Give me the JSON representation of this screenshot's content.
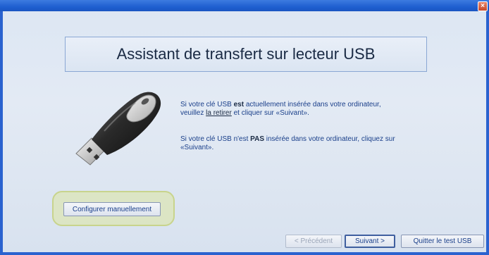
{
  "window": {
    "close_glyph": "×"
  },
  "header": {
    "title": "Assistant de transfert sur lecteur USB"
  },
  "message1": {
    "line1_a": "Si votre clé USB ",
    "line1_bold": "est",
    "line1_b": " actuellement insérée dans votre ordinateur,",
    "line2_a": "veuillez ",
    "line2_link": "la retirer",
    "line2_b": " et cliquer sur «Suivant»."
  },
  "message2": {
    "line1_a": "Si votre clé USB n'est ",
    "line1_bold": "PAS",
    "line1_b": " insérée dans votre ordinateur, cliquez sur",
    "line2": "«Suivant»."
  },
  "buttons": {
    "configure": "Configurer manuellement",
    "previous": "< Précédent",
    "next": "Suivant >",
    "quit": "Quitter le test USB"
  },
  "icons": {
    "usb": "usb-drive-icon",
    "close": "close-icon"
  }
}
